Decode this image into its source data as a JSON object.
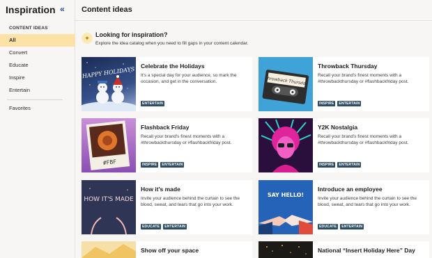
{
  "sidebar": {
    "title": "Inspiration",
    "collapse_icon": "«",
    "section_label": "CONTENT IDEAS",
    "items": [
      {
        "label": "All",
        "active": true
      },
      {
        "label": "Convert"
      },
      {
        "label": "Educate"
      },
      {
        "label": "Inspire"
      },
      {
        "label": "Entertain"
      }
    ],
    "favorites_label": "Favorites"
  },
  "header": {
    "title": "Content ideas"
  },
  "banner": {
    "icon": "sparkle-icon",
    "title": "Looking for inspiration?",
    "subtitle": "Explore the idea catalog when you need to fill gaps in your content calendar."
  },
  "cards": [
    {
      "title": "Celebrate the Holidays",
      "desc": "It's a special day for your audience, so mark the occasion, and get in the conversation.",
      "tags": [
        "ENTERTAIN"
      ],
      "thumb_text": "HAPPY HOLIDAYS"
    },
    {
      "title": "Throwback Thursday",
      "desc": "Recall your brand's finest moments with a #throwbackthursday or #flashbackfriday post.",
      "tags": [
        "INSPIRE",
        "ENTERTAIN"
      ],
      "thumb_text": "Throwback Thursday"
    },
    {
      "title": "Flashback Friday",
      "desc": "Recall your brand's finest moments with a #throwbackthursday or #flashbackfriday post.",
      "tags": [
        "INSPIRE",
        "ENTERTAIN"
      ],
      "thumb_text": "#FBF"
    },
    {
      "title": "Y2K Nostalgia",
      "desc": "Recall your brand's finest moments with a #throwbackthursday or #flashbackfriday post.",
      "tags": [
        "INSPIRE",
        "ENTERTAIN"
      ],
      "thumb_text": ""
    },
    {
      "title": "How it's made",
      "desc": "Invite your audience behind the curtain to see the blood, sweat, and tears that go into your work.",
      "tags": [
        "EDUCATE",
        "ENTERTAIN"
      ],
      "thumb_text": "HOW IT'S MADE"
    },
    {
      "title": "Introduce an employee",
      "desc": "Invite your audience behind the curtain to see the blood, sweat, and tears that go into your work.",
      "tags": [
        "EDUCATE",
        "ENTERTAIN"
      ],
      "thumb_text": "SAY HELLO!"
    },
    {
      "title": "Show off your space",
      "desc": "",
      "tags": [],
      "thumb_text": ""
    },
    {
      "title": "National “Insert Holiday Here” Day",
      "desc": "",
      "tags": [],
      "thumb_text": ""
    }
  ]
}
